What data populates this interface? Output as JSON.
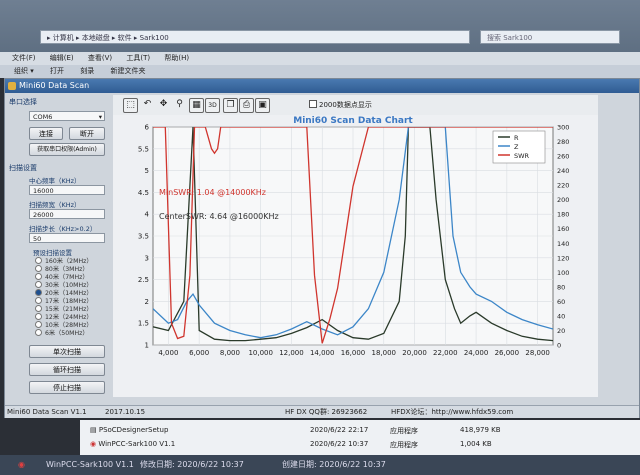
{
  "explorer": {
    "path": "▸ 计算机 ▸ 本地磁盘 ▸ 软件 ▸ Sark100",
    "search": "搜索 Sark100",
    "menu": [
      "文件(F)",
      "编辑(E)",
      "查看(V)",
      "工具(T)",
      "帮助(H)"
    ],
    "commands": [
      "组织 ▾",
      "打开",
      "刻录",
      "新建文件夹"
    ]
  },
  "window": {
    "title": "Mini60 Data Scan",
    "status_left": "Mini60 Data Scan V1.1",
    "status_date": "2017.10.15",
    "status_qq": "HF DX QQ群: 26923662",
    "status_site": "HFDX论坛：http://www.hfdx59.com"
  },
  "left_panel": {
    "serial_label": "串口选择",
    "serial_value": "COM6",
    "connect_btn": "连接",
    "disconnect_btn": "断开",
    "admin_btn": "获取串口权限(Admin)",
    "scan_settings_label": "扫描设置",
    "center_freq_label": "中心频率（KHz）",
    "center_freq_value": "16000",
    "span_label": "扫描频宽（KHz）",
    "span_value": "26000",
    "step_label": "扫描步长（KHz>0.2）",
    "step_value": "50",
    "preset_label": "预设扫描设置",
    "presets": [
      "160米（2MHz）",
      "80米（3MHz）",
      "40米（7MHz）",
      "30米（10MHz）",
      "20米（14MHz）",
      "17米（18MHz）",
      "15米（21MHz）",
      "12米（24MHz）",
      "10米（28MHz）",
      "6米（50MHz）"
    ],
    "selected_preset": 4,
    "single_scan_btn": "单次扫描",
    "loop_scan_btn": "循环扫描",
    "stop_scan_btn": "停止扫描"
  },
  "toolbar": {
    "checkbox_label": "2000数据点显示"
  },
  "chart_data": {
    "type": "line",
    "title": "Mini60 Scan Data Chart",
    "x_ticks": [
      "4,000",
      "6,000",
      "8,000",
      "10,000",
      "12,000",
      "14,000",
      "16,000",
      "18,000",
      "20,000",
      "22,000",
      "24,000",
      "26,000",
      "28,000"
    ],
    "xlim": [
      3000,
      29000
    ],
    "y_left_ticks": [
      "1",
      "1.5",
      "2",
      "2.5",
      "3",
      "3.5",
      "4",
      "4.5",
      "5",
      "5.5",
      "6"
    ],
    "ylim_left": [
      1,
      6
    ],
    "y_right_ticks": [
      "0",
      "20",
      "40",
      "60",
      "80",
      "100",
      "120",
      "140",
      "160",
      "180",
      "200",
      "220",
      "240",
      "260",
      "280",
      "300"
    ],
    "ylim_right": [
      0,
      300
    ],
    "annotations": [
      "MinSWR: 1.04 @14000KHz",
      "CenterSWR: 4.64 @16000KHz"
    ],
    "colors": {
      "R": "#2a3a2a",
      "Z": "#3c86c8",
      "SWR": "#d0352e"
    },
    "series": [
      {
        "name": "R",
        "axis": "right",
        "x": [
          3000,
          4000,
          5000,
          5600,
          6000,
          7000,
          8000,
          9000,
          10000,
          11000,
          12000,
          13000,
          14000,
          15000,
          16000,
          17000,
          18000,
          19000,
          19400,
          19600,
          20400,
          21000,
          21400,
          22000,
          22600,
          23000,
          23600,
          24000,
          25000,
          26000,
          27000,
          28000,
          29000
        ],
        "y": [
          25,
          20,
          60,
          300,
          20,
          8,
          6,
          6,
          8,
          10,
          16,
          24,
          35,
          20,
          10,
          8,
          16,
          60,
          150,
          300,
          300,
          300,
          200,
          90,
          50,
          30,
          40,
          45,
          30,
          20,
          12,
          8,
          6
        ]
      },
      {
        "name": "Z",
        "axis": "right",
        "x": [
          3000,
          4000,
          4600,
          5200,
          5600,
          6000,
          7000,
          8000,
          9000,
          10000,
          11000,
          12000,
          13000,
          14000,
          15000,
          16000,
          17000,
          18000,
          19000,
          19600,
          20000,
          22000,
          22500,
          23000,
          23600,
          24000,
          25000,
          26000,
          27000,
          28000,
          29000
        ],
        "y": [
          50,
          30,
          35,
          60,
          70,
          55,
          30,
          20,
          14,
          10,
          14,
          22,
          32,
          22,
          14,
          25,
          50,
          100,
          200,
          300,
          300,
          300,
          150,
          100,
          80,
          70,
          60,
          45,
          35,
          28,
          22
        ]
      },
      {
        "name": "SWR",
        "axis": "left",
        "x": [
          3000,
          3800,
          4200,
          4600,
          5000,
          5400,
          5700,
          6400,
          6800,
          7000,
          7200,
          7400,
          8000,
          9000,
          10000,
          11000,
          12000,
          13000,
          13500,
          14000,
          14500,
          15000,
          16000,
          17000,
          18000,
          19000,
          20000,
          21000,
          21500,
          21900,
          22200,
          22500,
          29000
        ],
        "y": [
          6,
          6,
          1.5,
          1.15,
          1.2,
          2.6,
          6,
          6,
          5.5,
          5.4,
          5.5,
          6,
          6,
          6,
          6,
          6,
          6,
          6,
          2.6,
          1.04,
          1.6,
          2.3,
          4.64,
          6,
          6,
          6,
          6,
          6,
          6,
          6,
          6,
          6,
          6
        ]
      }
    ]
  },
  "lower_list": {
    "rows": [
      {
        "name": "PSoCDesignerSetup",
        "date": "2020/6/22 22:17",
        "type": "应用程序",
        "size": "418,979 KB"
      },
      {
        "name": "WinPCC-Sark100 V1.1",
        "date": "2020/6/22 10:37",
        "type": "应用程序",
        "size": "1,004 KB"
      }
    ]
  },
  "taskbar": {
    "app": "WinPCC-Sark100 V1.1",
    "modified": "修改日期: 2020/6/22 10:37",
    "created": "创建日期: 2020/6/22 10:37"
  }
}
